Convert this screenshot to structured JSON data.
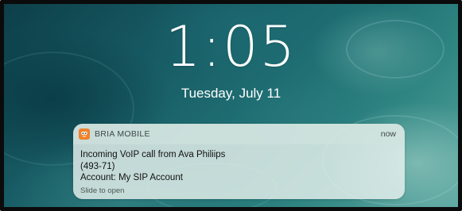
{
  "lock_screen": {
    "time": "1:05",
    "date": "Tuesday, July 11"
  },
  "notification": {
    "app_icon": "bria-logo-icon",
    "app_name": "BRIA MOBILE",
    "timestamp": "now",
    "lines": [
      "Incoming VoIP call from Ava Philiips",
      "(493-71)",
      "Account: My SIP Account"
    ],
    "action_hint": "Slide to open"
  },
  "colors": {
    "app_icon_bg": "#f0822a",
    "wallpaper_base": "#1f6f73"
  }
}
